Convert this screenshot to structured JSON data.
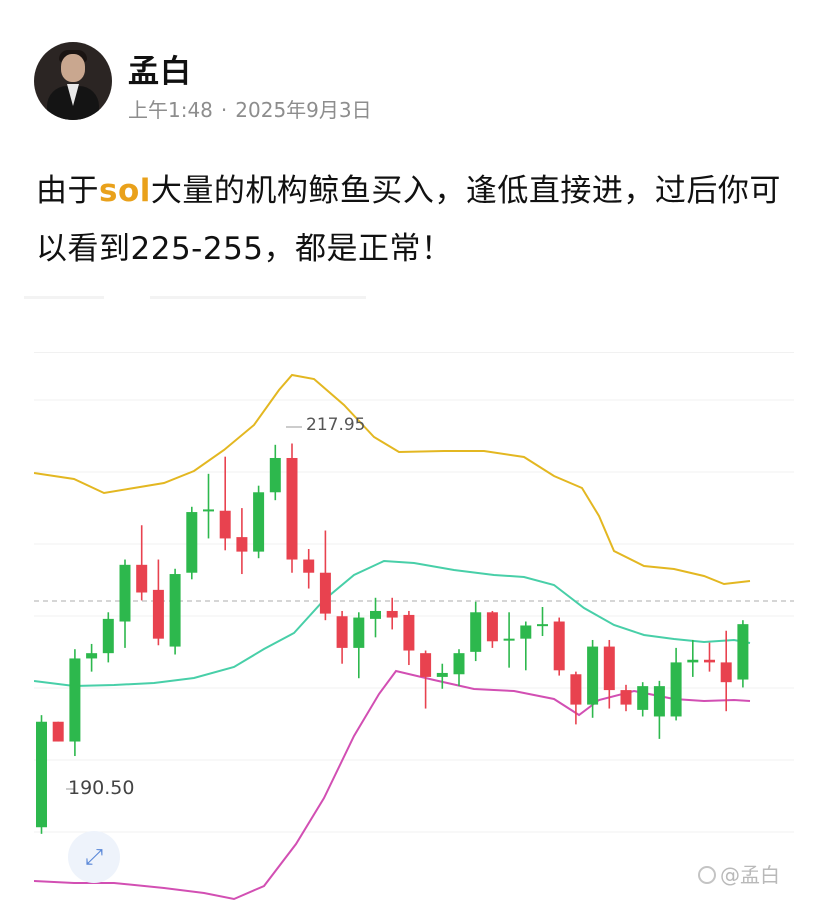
{
  "author": {
    "name": "孟白",
    "time": "上午1:48",
    "separator": "·",
    "date": "2025年9月3日"
  },
  "post": {
    "text_part1": "由于",
    "highlight": "sol",
    "text_part2": "大量的机构鲸鱼买入，逢低直接进，过后你可以看到225-255，都是正常！",
    "highlight_color": "#e9a11b"
  },
  "chart": {
    "high_label": "217.95",
    "low_label": "190.50",
    "up_color": "#2db84d",
    "down_color": "#e8424f",
    "upper_band_color": "#e3b721",
    "mid_band_color": "#48cfa8",
    "lower_band_color": "#d24fb3"
  },
  "watermark": {
    "icon": "weibo-logo-icon",
    "text": "@孟白"
  },
  "icons": {
    "expand": "expand-icon"
  },
  "chart_data": {
    "type": "candlestick",
    "price_labels": [
      217.95,
      190.5
    ],
    "y_scale_reference": {
      "217.95": 217.95,
      "190.50": 190.5
    },
    "candles": [
      {
        "dir": "up",
        "open": 187.6,
        "close": 195.6,
        "high": 196.1,
        "low": 187.1
      },
      {
        "dir": "down",
        "open": 195.6,
        "close": 194.1,
        "high": 195.6,
        "low": 194.1
      },
      {
        "dir": "up",
        "open": 194.1,
        "close": 200.4,
        "high": 201.1,
        "low": 193.0
      },
      {
        "dir": "up",
        "open": 200.4,
        "close": 200.8,
        "high": 201.5,
        "low": 199.4
      },
      {
        "dir": "up",
        "open": 200.8,
        "close": 203.4,
        "high": 203.9,
        "low": 200.1
      },
      {
        "dir": "up",
        "open": 203.2,
        "close": 207.5,
        "high": 207.9,
        "low": 201.2
      },
      {
        "dir": "down",
        "open": 207.5,
        "close": 205.4,
        "high": 210.5,
        "low": 204.8
      },
      {
        "dir": "down",
        "open": 205.6,
        "close": 201.9,
        "high": 207.9,
        "low": 201.4
      },
      {
        "dir": "up",
        "open": 201.3,
        "close": 206.8,
        "high": 207.2,
        "low": 200.7
      },
      {
        "dir": "up",
        "open": 206.9,
        "close": 211.5,
        "high": 211.9,
        "low": 206.4
      },
      {
        "dir": "up",
        "open": 211.6,
        "close": 211.7,
        "high": 214.4,
        "low": 209.5
      },
      {
        "dir": "down",
        "open": 211.6,
        "close": 209.5,
        "high": 215.7,
        "low": 208.6
      },
      {
        "dir": "down",
        "open": 209.6,
        "close": 208.5,
        "high": 211.8,
        "low": 206.8
      },
      {
        "dir": "up",
        "open": 208.5,
        "close": 213.0,
        "high": 213.5,
        "low": 208.0
      },
      {
        "dir": "up",
        "open": 213.0,
        "close": 215.6,
        "high": 216.6,
        "low": 212.4
      },
      {
        "dir": "down",
        "open": 215.6,
        "close": 207.9,
        "high": 216.7,
        "low": 206.9
      },
      {
        "dir": "down",
        "open": 207.9,
        "close": 206.9,
        "high": 208.7,
        "low": 205.7
      },
      {
        "dir": "down",
        "open": 206.9,
        "close": 203.8,
        "high": 210.1,
        "low": 203.3
      },
      {
        "dir": "down",
        "open": 203.6,
        "close": 201.2,
        "high": 204.0,
        "low": 200.0
      },
      {
        "dir": "up",
        "open": 201.2,
        "close": 203.5,
        "high": 203.9,
        "low": 198.9
      },
      {
        "dir": "up",
        "open": 203.4,
        "close": 204.0,
        "high": 205.0,
        "low": 202.0
      },
      {
        "dir": "down",
        "open": 204.0,
        "close": 203.5,
        "high": 205.0,
        "low": 202.6
      },
      {
        "dir": "down",
        "open": 203.7,
        "close": 201.0,
        "high": 204.0,
        "low": 199.9
      },
      {
        "dir": "down",
        "open": 200.8,
        "close": 199.0,
        "high": 201.0,
        "low": 196.6
      },
      {
        "dir": "up",
        "open": 199.0,
        "close": 199.3,
        "high": 200.0,
        "low": 198.1
      },
      {
        "dir": "up",
        "open": 199.2,
        "close": 200.8,
        "high": 201.1,
        "low": 198.3
      },
      {
        "dir": "up",
        "open": 200.9,
        "close": 203.9,
        "high": 204.7,
        "low": 200.2
      },
      {
        "dir": "down",
        "open": 203.9,
        "close": 201.7,
        "high": 204.0,
        "low": 201.2
      },
      {
        "dir": "up",
        "open": 201.8,
        "close": 201.9,
        "high": 203.9,
        "low": 199.7
      },
      {
        "dir": "up",
        "open": 201.9,
        "close": 202.9,
        "high": 203.2,
        "low": 199.5
      },
      {
        "dir": "up",
        "open": 202.9,
        "close": 203.0,
        "high": 204.3,
        "low": 202.1
      },
      {
        "dir": "down",
        "open": 203.2,
        "close": 199.5,
        "high": 203.5,
        "low": 199.1
      },
      {
        "dir": "down",
        "open": 199.2,
        "close": 196.9,
        "high": 199.4,
        "low": 195.4
      },
      {
        "dir": "up",
        "open": 196.9,
        "close": 201.3,
        "high": 201.8,
        "low": 195.9
      },
      {
        "dir": "down",
        "open": 201.3,
        "close": 198.0,
        "high": 201.8,
        "low": 196.6
      },
      {
        "dir": "down",
        "open": 198.0,
        "close": 196.9,
        "high": 198.4,
        "low": 196.4
      },
      {
        "dir": "up",
        "open": 196.5,
        "close": 198.3,
        "high": 198.6,
        "low": 196.0
      },
      {
        "dir": "up",
        "open": 196.0,
        "close": 198.3,
        "high": 198.7,
        "low": 194.3
      },
      {
        "dir": "up",
        "open": 196.0,
        "close": 200.1,
        "high": 201.2,
        "low": 195.7
      },
      {
        "dir": "up",
        "open": 200.1,
        "close": 200.3,
        "high": 201.8,
        "low": 199.0
      },
      {
        "dir": "down",
        "open": 200.3,
        "close": 200.1,
        "high": 201.6,
        "low": 199.4
      },
      {
        "dir": "down",
        "open": 200.1,
        "close": 198.6,
        "high": 202.5,
        "low": 196.4
      },
      {
        "dir": "up",
        "open": 198.8,
        "close": 203.0,
        "high": 203.3,
        "low": 198.2
      }
    ]
  }
}
